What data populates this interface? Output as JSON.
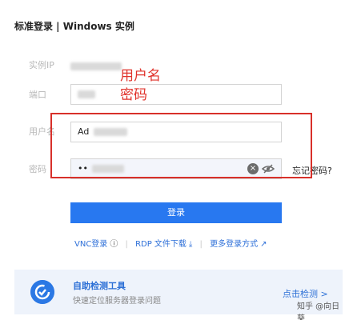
{
  "title": "标准登录 | Windows 实例",
  "fields": {
    "instance_ip_label": "实例IP",
    "port_label": "端口",
    "username_label": "用户名",
    "username_value": "Ad",
    "password_label": "密码",
    "password_value": "••"
  },
  "annotation": {
    "line1": "用户名",
    "line2": "密码"
  },
  "forgot_password": "忘记密码?",
  "login_button": "登录",
  "links": {
    "vnc": "VNC登录",
    "rdp": "RDP 文件下载",
    "more": "更多登录方式"
  },
  "tool": {
    "title": "自助检测工具",
    "subtitle": "快速定位服务器登录问题",
    "action": "点击检测 >",
    "watermark": "知乎 @向日葵"
  },
  "colors": {
    "primary": "#2878f0",
    "annotation": "#d8302a"
  }
}
